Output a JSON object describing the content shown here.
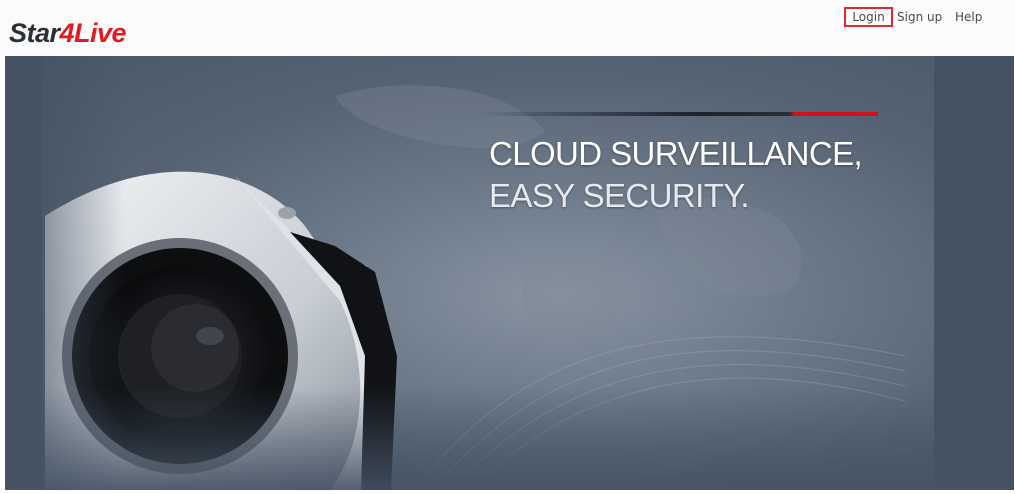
{
  "header": {
    "logo": {
      "part1": "Star",
      "part2": "4Live"
    },
    "nav": {
      "login": "Login",
      "signup": "Sign up",
      "help": "Help"
    }
  },
  "hero": {
    "slogan_line1": "CLOUD SURVEILLANCE,",
    "slogan_line2": "EASY SECURITY."
  },
  "colors": {
    "brand_red": "#e11b22",
    "logo_dark": "#2b2f36",
    "hero_bg": "#445263"
  },
  "icons": [
    "camera-illustration",
    "world-map-background"
  ]
}
